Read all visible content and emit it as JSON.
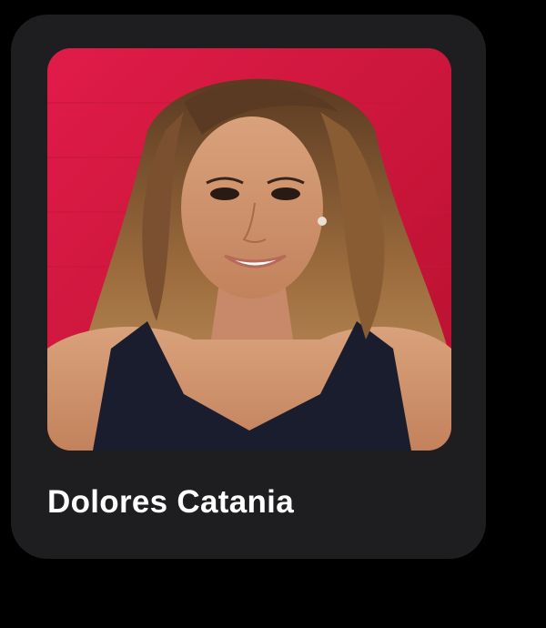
{
  "card": {
    "name": "Dolores Catania",
    "photo_icon": "portrait-photo",
    "colors": {
      "page_background": "#000000",
      "card_background": "#1e1e21",
      "photo_backdrop": "#d41a43",
      "name_text": "#ffffff"
    }
  }
}
